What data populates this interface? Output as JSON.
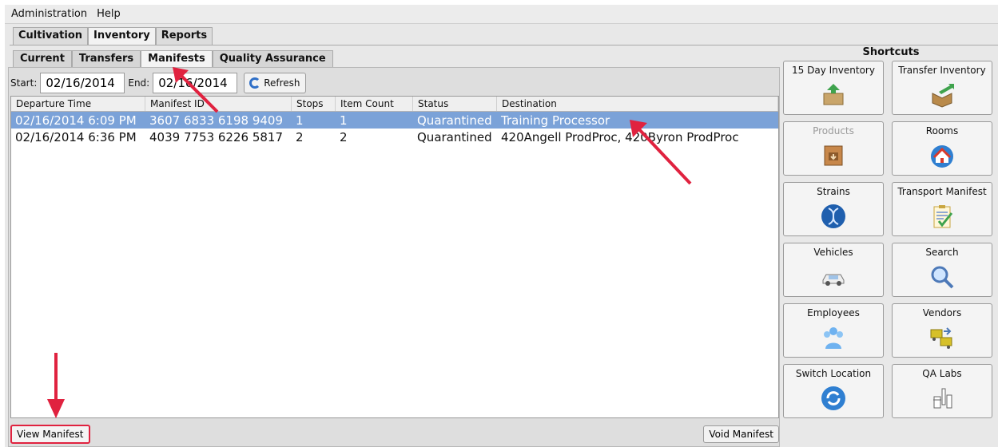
{
  "menu": {
    "items": [
      "Administration",
      "Help"
    ]
  },
  "main_tabs": [
    {
      "label": "Cultivation"
    },
    {
      "label": "Inventory"
    },
    {
      "label": "Reports"
    }
  ],
  "sub_tabs": [
    {
      "label": "Current"
    },
    {
      "label": "Transfers"
    },
    {
      "label": "Manifests"
    },
    {
      "label": "Quality Assurance"
    }
  ],
  "filters": {
    "start_label": "Start:",
    "start_value": "02/16/2014",
    "end_label": "End:",
    "end_value": "02/16/2014",
    "refresh_label": "Refresh"
  },
  "table": {
    "columns": [
      "Departure Time",
      "Manifest ID",
      "Stops",
      "Item Count",
      "Status",
      "Destination"
    ],
    "rows": [
      {
        "departure": "02/16/2014 6:09 PM",
        "manifest_id": "3607 6833 6198 9409",
        "stops": "1",
        "items": "1",
        "status": "Quarantined",
        "destination": "Training Processor"
      },
      {
        "departure": "02/16/2014 6:36 PM",
        "manifest_id": "4039 7753 6226 5817",
        "stops": "2",
        "items": "2",
        "status": "Quarantined",
        "destination": "420Angell ProdProc, 420Byron ProdProc"
      }
    ]
  },
  "actions": {
    "view": "View Manifest",
    "void": "Void Manifest"
  },
  "shortcuts": {
    "title": "Shortcuts",
    "items": [
      {
        "label": "15 Day Inventory",
        "icon": "inventory-box-icon"
      },
      {
        "label": "Transfer Inventory",
        "icon": "transfer-box-icon"
      },
      {
        "label": "Products",
        "icon": "products-crate-icon"
      },
      {
        "label": "Rooms",
        "icon": "rooms-house-icon"
      },
      {
        "label": "Strains",
        "icon": "strains-dna-icon"
      },
      {
        "label": "Transport Manifest",
        "icon": "clipboard-check-icon"
      },
      {
        "label": "Vehicles",
        "icon": "car-icon"
      },
      {
        "label": "Search",
        "icon": "magnifier-icon"
      },
      {
        "label": "Employees",
        "icon": "people-icon"
      },
      {
        "label": "Vendors",
        "icon": "vendor-trucks-icon"
      },
      {
        "label": "Switch Location",
        "icon": "switch-arrows-icon"
      },
      {
        "label": "QA Labs",
        "icon": "lab-beakers-icon"
      }
    ]
  },
  "colors": {
    "selection": "#7ba2d8",
    "annotation_red": "#e0223f"
  }
}
